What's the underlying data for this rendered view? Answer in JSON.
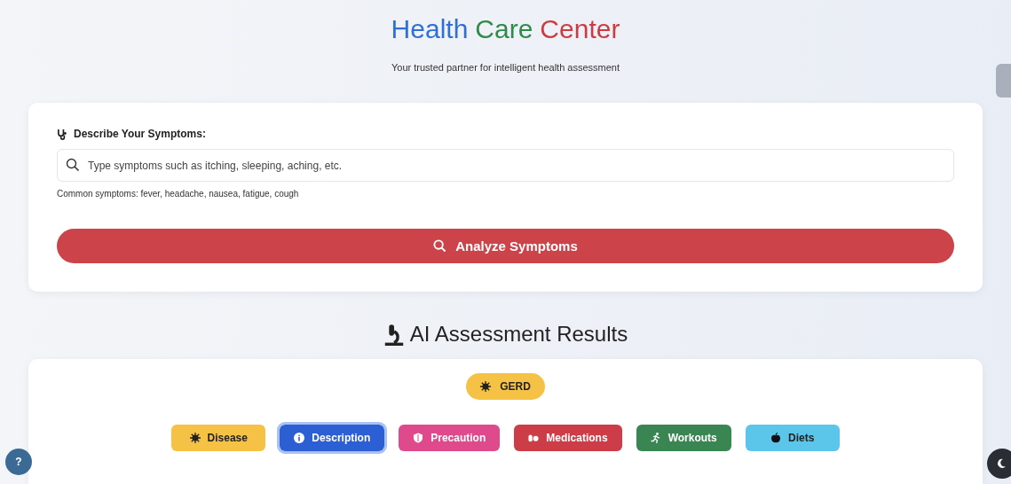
{
  "header": {
    "title_words": [
      {
        "text": "Health",
        "color": "#2f6fd6"
      },
      {
        "text": "Care",
        "color": "#2f8a4c"
      },
      {
        "text": "Center",
        "color": "#cc3d43"
      }
    ],
    "subtitle": "Your trusted partner for intelligent health assessment"
  },
  "symptom_form": {
    "label": "Describe Your Symptoms:",
    "placeholder": "Type symptoms such as itching, sleeping, aching, etc.",
    "hint": "Common symptoms: fever, headache, nausea, fatigue, cough",
    "button": "Analyze Symptoms"
  },
  "results": {
    "heading": "AI Assessment Results",
    "disease": "GERD",
    "tabs": [
      {
        "label": "Disease",
        "kind": "disease",
        "color": "#f5c245",
        "selected": false
      },
      {
        "label": "Description",
        "kind": "description",
        "color": "#2c5fd4",
        "selected": true
      },
      {
        "label": "Precaution",
        "kind": "precaution",
        "color": "#df4a8c",
        "selected": false
      },
      {
        "label": "Medications",
        "kind": "medications",
        "color": "#cc3d47",
        "selected": false
      },
      {
        "label": "Workouts",
        "kind": "workouts",
        "color": "#3a8652",
        "selected": false
      },
      {
        "label": "Diets",
        "kind": "diets",
        "color": "#5cc6ea",
        "selected": false
      }
    ]
  },
  "help_button": "?"
}
